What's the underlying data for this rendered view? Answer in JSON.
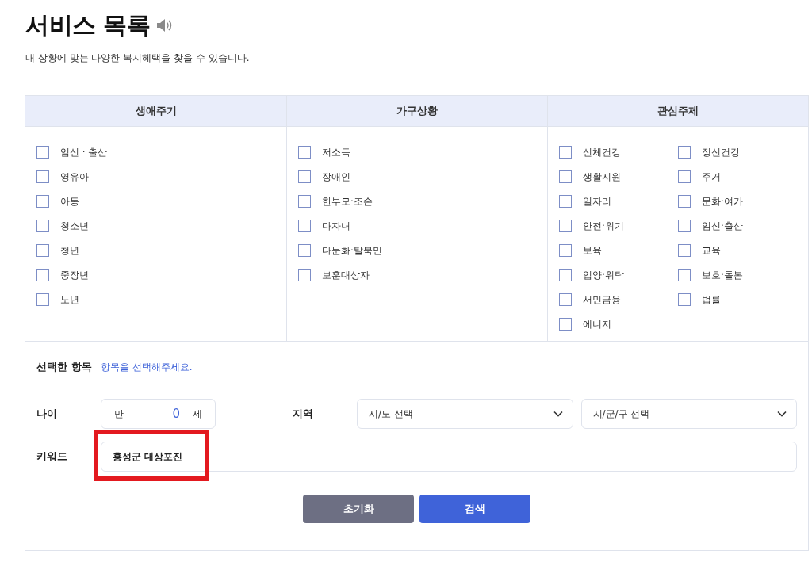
{
  "title": "서비스 목록",
  "subtitle": "내 상황에 맞는 다양한 복지혜택을 찾을 수 있습니다.",
  "filter_groups": [
    {
      "heading": "생애주기",
      "kind": "list",
      "options": [
        {
          "label": "임신 · 출산",
          "checked": false
        },
        {
          "label": "영유아",
          "checked": false
        },
        {
          "label": "아동",
          "checked": false
        },
        {
          "label": "청소년",
          "checked": false
        },
        {
          "label": "청년",
          "checked": false
        },
        {
          "label": "중장년",
          "checked": false
        },
        {
          "label": "노년",
          "checked": false
        }
      ]
    },
    {
      "heading": "가구상황",
      "kind": "list",
      "options": [
        {
          "label": "저소득",
          "checked": false
        },
        {
          "label": "장애인",
          "checked": false
        },
        {
          "label": "한부모·조손",
          "checked": false
        },
        {
          "label": "다자녀",
          "checked": false
        },
        {
          "label": "다문화·탈북민",
          "checked": false
        },
        {
          "label": "보훈대상자",
          "checked": false
        }
      ]
    },
    {
      "heading": "관심주제",
      "kind": "grid",
      "options": [
        {
          "label": "신체건강",
          "checked": false
        },
        {
          "label": "정신건강",
          "checked": false
        },
        {
          "label": "생활지원",
          "checked": false
        },
        {
          "label": "주거",
          "checked": false
        },
        {
          "label": "일자리",
          "checked": false
        },
        {
          "label": "문화·여가",
          "checked": false
        },
        {
          "label": "안전·위기",
          "checked": false
        },
        {
          "label": "임신·출산",
          "checked": false
        },
        {
          "label": "보육",
          "checked": false
        },
        {
          "label": "교육",
          "checked": false
        },
        {
          "label": "입양·위탁",
          "checked": false
        },
        {
          "label": "보호·돌봄",
          "checked": false
        },
        {
          "label": "서민금융",
          "checked": false
        },
        {
          "label": "법률",
          "checked": false
        },
        {
          "label": "에너지",
          "checked": false
        }
      ]
    }
  ],
  "selected_items": {
    "label": "선택한 항목",
    "placeholder": "항목을 선택해주세요."
  },
  "age": {
    "label": "나이",
    "prefix": "만",
    "value": "0",
    "unit": "세"
  },
  "region": {
    "label": "지역",
    "selects": [
      {
        "value": "시/도 선택"
      },
      {
        "value": "시/군/구 선택"
      }
    ]
  },
  "keyword": {
    "label": "키워드",
    "value": "홍성군 대상포진",
    "highlighted": true
  },
  "buttons": [
    {
      "label": "초기화",
      "kind": "reset"
    },
    {
      "label": "검색",
      "kind": "search"
    }
  ]
}
